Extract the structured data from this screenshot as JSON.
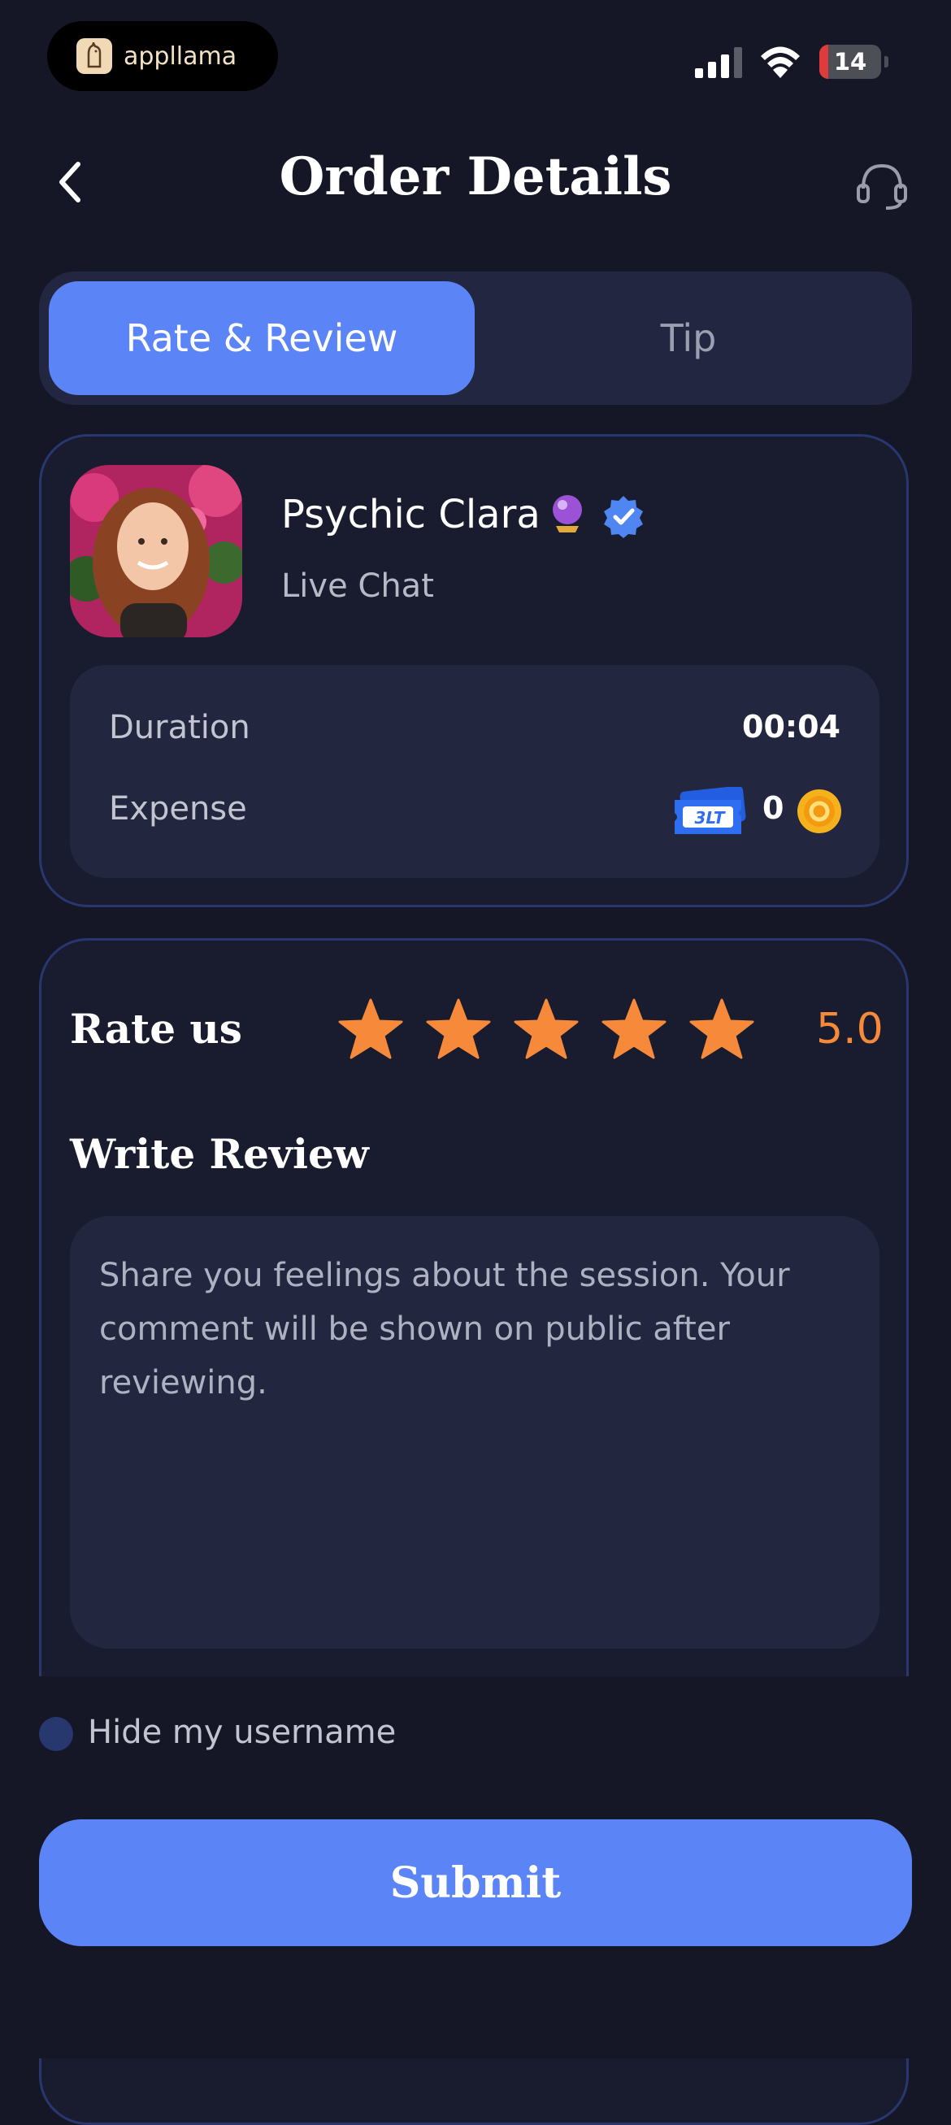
{
  "status_bar": {
    "app_pill_name": "appllama",
    "battery": "14",
    "icons": [
      "appllama-logo-icon",
      "signal-icon",
      "wifi-icon",
      "battery-icon"
    ]
  },
  "header": {
    "title": "Order Details",
    "icons": [
      "back-chevron-icon",
      "headset-support-icon"
    ]
  },
  "tabs": [
    {
      "label": "Rate & Review",
      "active": true
    },
    {
      "label": "Tip",
      "active": false
    }
  ],
  "advisor": {
    "name": "Psychic Clara",
    "service": "Live Chat",
    "badges": [
      "crystal-ball-icon",
      "verified-badge-icon"
    ],
    "duration_label": "Duration",
    "duration_value": "00:04",
    "expense_label": "Expense",
    "expense_ticket": "3LT",
    "expense_value": "0"
  },
  "rating": {
    "label": "Rate us",
    "stars": 5,
    "max_stars": 5,
    "score": "5.0"
  },
  "review": {
    "label": "Write Review",
    "placeholder": "Share you feelings about the session. Your comment will be shown on public after reviewing.",
    "value": ""
  },
  "hide_username": {
    "label": "Hide my username",
    "checked": false
  },
  "submit_label": "Submit",
  "colors": {
    "background": "#151726",
    "accent": "#5b85f6",
    "star": "#f78a3a",
    "card_border": "#28376e"
  }
}
